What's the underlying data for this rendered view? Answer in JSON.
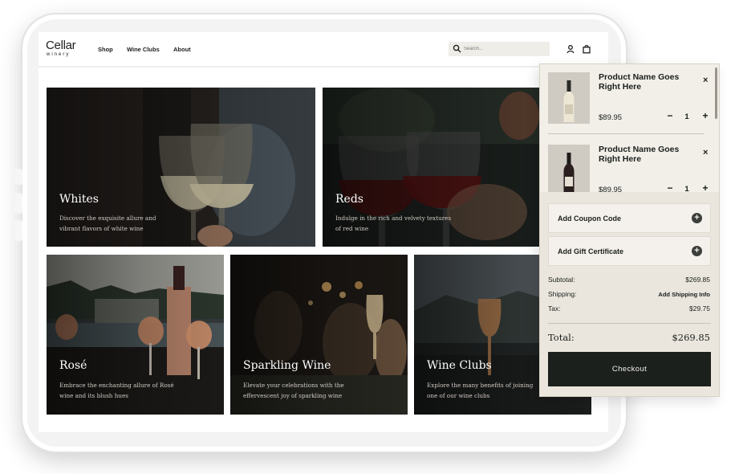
{
  "brand": {
    "name": "Cellar",
    "tagline": "winery"
  },
  "nav": {
    "items": [
      "Shop",
      "Wine Clubs",
      "About"
    ]
  },
  "search": {
    "placeholder": "Search..."
  },
  "header_icons": [
    "search-icon",
    "account-icon",
    "bag-icon"
  ],
  "categories": [
    {
      "title": "Whites",
      "description": "Discover the exquisite allure and vibrant flavors of white wine"
    },
    {
      "title": "Reds",
      "description": "Indulge in the rich and velvety textures of red wine"
    },
    {
      "title": "Rosé",
      "description": "Embrace the enchanting allure of Rosé wine and its blush hues"
    },
    {
      "title": "Sparkling Wine",
      "description": "Elevate your celebrations with the effervescent joy of sparkling wine"
    },
    {
      "title": "Wine Clubs",
      "description": "Explore the many benefits of joining one of our wine clubs"
    }
  ],
  "cart": {
    "items": [
      {
        "name": "Product Name Goes Right Here",
        "price": "$89.95",
        "quantity": "1",
        "minus": "−",
        "plus": "+",
        "remove": "×"
      },
      {
        "name": "Product Name Goes Right Here",
        "price": "$89.95",
        "quantity": "1",
        "minus": "−",
        "plus": "+",
        "remove": "×"
      }
    ],
    "options": [
      {
        "label": "Add Coupon Code",
        "icon": "+"
      },
      {
        "label": "Add Gift Certificate",
        "icon": "+"
      }
    ],
    "summary": {
      "subtotal_label": "Subtotal:",
      "subtotal_value": "$269.85",
      "shipping_label": "Shipping:",
      "shipping_value": "Add Shipping Info",
      "tax_label": "Tax:",
      "tax_value": "$29.75",
      "total_label": "Total:",
      "total_value": "$269.85"
    },
    "checkout_label": "Checkout"
  },
  "colors": {
    "ink": "#1b1f1b",
    "cart_background": "#eae6de",
    "search_background": "#efede7",
    "checkout_button": "#1c201c"
  }
}
